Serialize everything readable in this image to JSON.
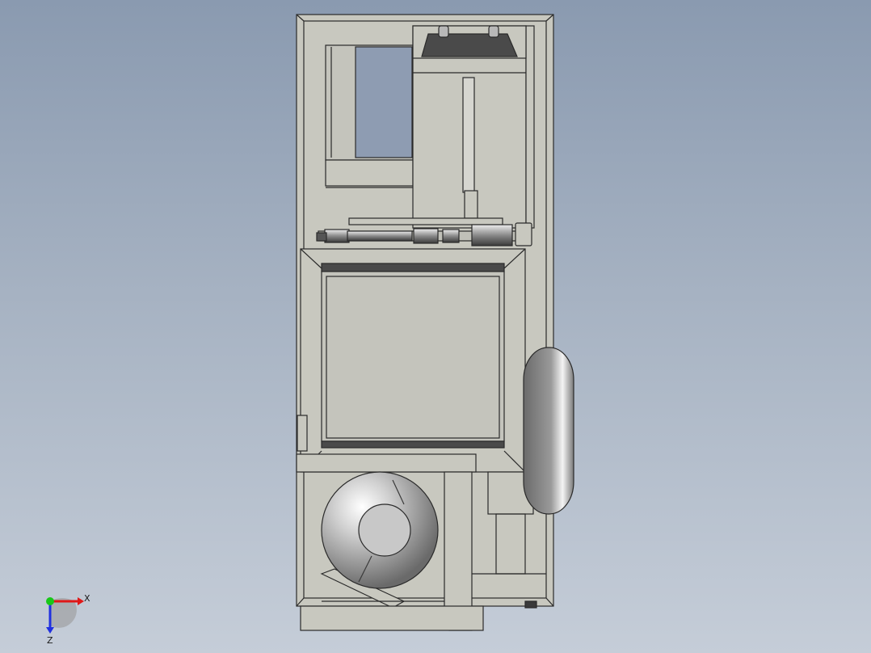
{
  "triad": {
    "x_label": "X",
    "z_label": "Z",
    "colors": {
      "x": "#e01818",
      "y": "#18c818",
      "z": "#2030e0"
    }
  },
  "model": {
    "icon": "cad-machine-assembly-front-view",
    "colors": {
      "frame": "#c8c8bf",
      "outline": "#2a2a2a",
      "dark": "#4a4a4a",
      "panel": "#c4c4bc"
    }
  }
}
